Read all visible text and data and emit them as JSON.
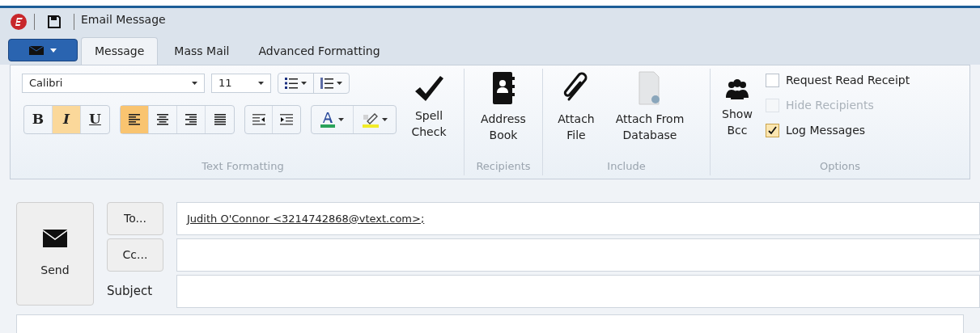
{
  "window": {
    "title": "Email Message"
  },
  "tabs": [
    {
      "label": "Message",
      "selected": true
    },
    {
      "label": "Mass Mail",
      "selected": false
    },
    {
      "label": "Advanced Formatting",
      "selected": false
    }
  ],
  "font": {
    "name": "Calibri",
    "size": "11"
  },
  "style_buttons": [
    {
      "kind": "bold",
      "label": "B",
      "selected": false
    },
    {
      "kind": "italic",
      "label": "I",
      "selected": true
    },
    {
      "kind": "underline",
      "label": "U",
      "selected": false
    }
  ],
  "align_buttons": [
    {
      "kind": "left",
      "selected": true
    },
    {
      "kind": "center",
      "selected": false
    },
    {
      "kind": "right",
      "selected": false
    },
    {
      "kind": "justify",
      "selected": false
    }
  ],
  "spell_check": "Spell Check",
  "groups": [
    {
      "label": "Text Formatting"
    },
    {
      "label": "Recipients"
    },
    {
      "label": "Include"
    },
    {
      "label": "Options"
    }
  ],
  "address_book": "Address Book",
  "include_buttons": [
    {
      "kind": "attach",
      "label": "Attach File"
    },
    {
      "kind": "database",
      "label": "Attach From Database"
    }
  ],
  "show_bcc": "Show Bcc",
  "options": [
    {
      "label": "Request Read Receipt",
      "checked": false,
      "disabled": false
    },
    {
      "label": "Hide Recipients",
      "checked": false,
      "disabled": true
    },
    {
      "label": "Log Messages",
      "checked": true,
      "disabled": false
    }
  ],
  "send": "Send",
  "to": {
    "button": "To...",
    "value": "Judith O'Connor <3214742868@vtext.com>;"
  },
  "cc": {
    "button": "Cc..."
  },
  "subject": {
    "label": "Subject"
  }
}
